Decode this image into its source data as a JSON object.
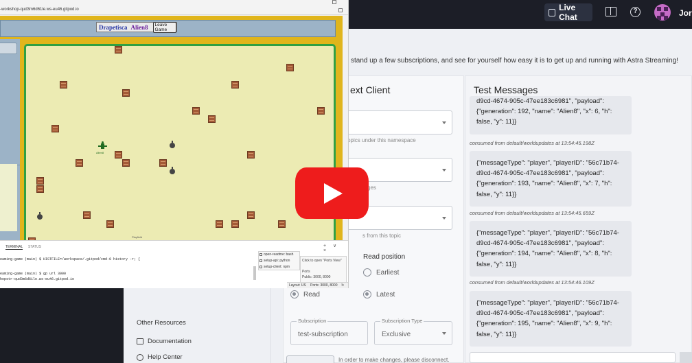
{
  "topbar": {
    "live_chat_label": "Live Chat",
    "book_icon": "book-icon",
    "help_icon": "help-icon",
    "username": "Jorg"
  },
  "page": {
    "subtitle": "stand up a few subscriptions, and see for yourself how easy it is to get up and running with Astra Streaming!"
  },
  "client": {
    "title": "ext Client",
    "topic_hint": "m topics under this namespace",
    "hint2": "ges",
    "hint3": "s from this topic",
    "read_position_label": "Read position",
    "read_option": "Read",
    "earliest_option": "Earliest",
    "latest_option": "Latest",
    "subscription_label": "Subscription",
    "subscription_value": "test-subscription",
    "subscription_type_label": "Subscription Type",
    "subscription_type_value": "Exclusive",
    "disconnect_note": "In order to make changes, please disconnect."
  },
  "resources": {
    "title": "Other Resources",
    "documentation": "Documentation",
    "help_center": "Help Center"
  },
  "messages": {
    "title": "Test Messages",
    "cards": [
      {
        "lines": [
          "d9cd-4674-905c-47ee183c6981\", \"payload\":",
          "{\"generation\": 192, \"name\": \"Alien8\", \"x\": 6, \"h\":",
          "false, \"y\": 11}}"
        ]
      },
      {
        "lines": [
          "{\"messageType\": \"player\", \"playerID\": \"56c71b74-",
          "d9cd-4674-905c-47ee183c6981\", \"payload\":",
          "{\"generation\": 193, \"name\": \"Alien8\", \"x\": 7, \"h\":",
          "false, \"y\": 11}}"
        ]
      },
      {
        "lines": [
          "{\"messageType\": \"player\", \"playerID\": \"56c71b74-",
          "d9cd-4674-905c-47ee183c6981\", \"payload\":",
          "{\"generation\": 194, \"name\": \"Alien8\", \"x\": 8, \"h\":",
          "false, \"y\": 11}}"
        ]
      },
      {
        "lines": [
          "{\"messageType\": \"player\", \"playerID\": \"56c71b74-",
          "d9cd-4674-905c-47ee183c6981\", \"payload\":",
          "{\"generation\": 195, \"name\": \"Alien8\", \"x\": 9, \"h\":",
          "false, \"y\": 11}}"
        ]
      }
    ],
    "consumed": [
      "consumed from default/worldupdates at 13:54:45.198Z",
      "consumed from default/worldupdates at 13:54:45.659Z",
      "consumed from default/worldupdates at 13:54:46.109Z"
    ]
  },
  "overlay": {
    "url": "-workshop-qud3m6d61le.ws-eu46.gitpod.io",
    "game_name": "Drapetisca",
    "player_name": "Alien8",
    "leave_button": "Leave Game",
    "alien_label": "Alien8",
    "field_label": "Playfield",
    "terminal_tab": "TERMINAL",
    "other_tab": "STATUS",
    "terminal_controls": "+ ∨ ×",
    "terminal_lines": [
      "eaming-game (main) $  HISTFILE=/workspace/.gitpod/cmd-0 history -r; {",
      "eaming-game (main) $  gp url 3000",
      "hopstr-qud3m6d61le.ws-eu46.gitpod.io"
    ],
    "tasks": [
      "open-readme: bash",
      "setup-api: python",
      "setup-client: npm"
    ],
    "popup_lines": [
      "Click to open \"Ports View\"",
      "Ports",
      "Public: 3000, 8000"
    ],
    "status_layout": "Layout: US",
    "status_ports": "Ports: 3000, 8000"
  },
  "video": {
    "play_icon": "play-icon",
    "play_button_color": "#ee1c1c"
  }
}
